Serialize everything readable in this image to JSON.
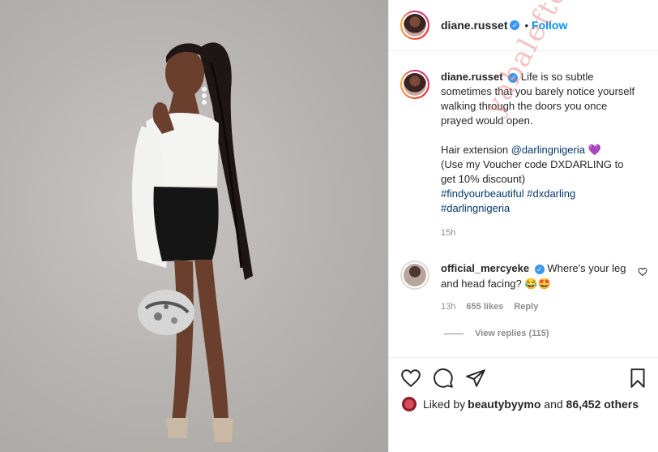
{
  "post": {
    "username": "diane.russet",
    "dot": "•",
    "follow_label": "Follow",
    "verified_glyph": "✓"
  },
  "caption": {
    "username": "diane.russet",
    "line1": "Life is so subtle sometimes that you barely notice yourself walking through the doors you once prayed would open.",
    "hair_prefix": "Hair extension ",
    "hair_mention": "@darlingnigeria",
    "hair_emoji": "💜",
    "voucher": "(Use my Voucher code DXDARLING to get 10% discount)",
    "tag1": "#findyourbeautiful",
    "tag2": "#dxdarling",
    "tag3": "#darlingnigeria",
    "time": "15h"
  },
  "comment": {
    "username": "official_mercyeke",
    "text": "Where's your leg and head facing? 😂🤩",
    "time": "13h",
    "likes": "655 likes",
    "reply": "Reply",
    "view_replies": "View replies (115)"
  },
  "likes": {
    "prefix": "Liked by ",
    "user": "beautybyymo",
    "middle": " and ",
    "count": "86,452 others"
  },
  "watermark": "yabaleftonline",
  "colors": {
    "accent": "#0095f6",
    "verified": "#3897f0",
    "link": "#00376b",
    "muted": "#8e8e8e"
  },
  "icons": [
    "heart-icon",
    "comment-icon",
    "share-icon",
    "bookmark-icon",
    "verified-icon"
  ]
}
